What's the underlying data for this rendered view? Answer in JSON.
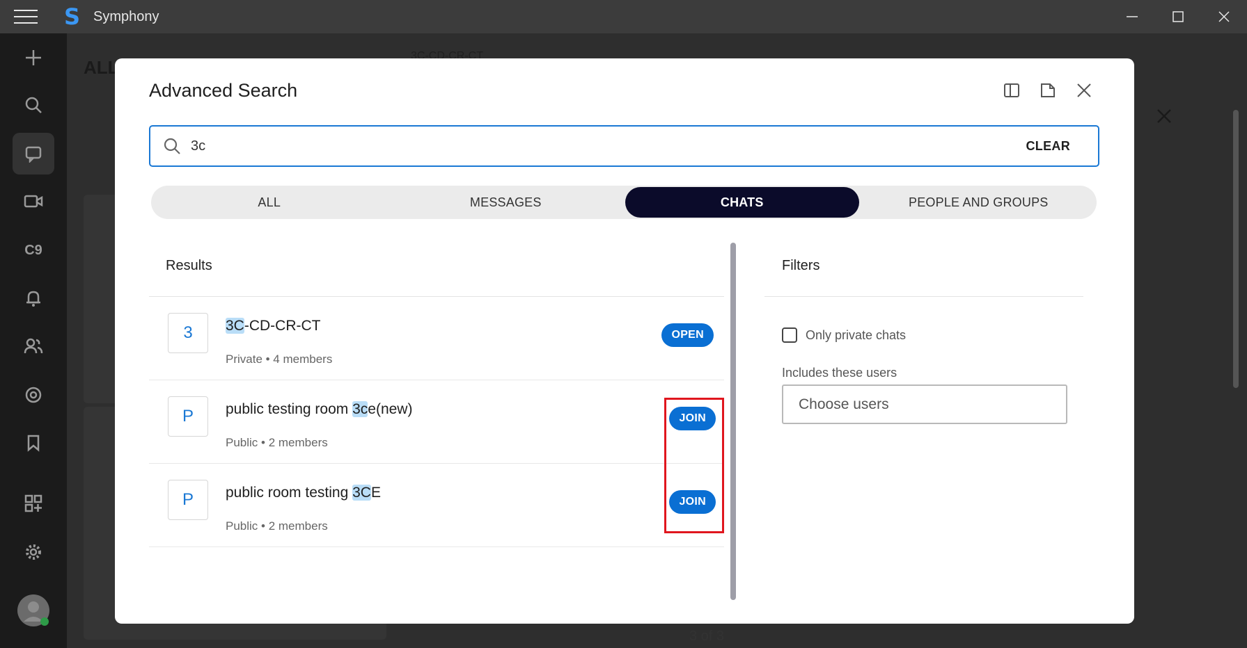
{
  "app": {
    "title": "Symphony",
    "logo": "S"
  },
  "background": {
    "list_title": "ALL",
    "chat_title": "3C-CD-CR-CT",
    "rail_c9": "C9"
  },
  "modal": {
    "title": "Advanced Search",
    "search": {
      "value": "3c",
      "clear_label": "CLEAR"
    },
    "tabs": [
      {
        "label": "ALL",
        "active": false
      },
      {
        "label": "MESSAGES",
        "active": false
      },
      {
        "label": "CHATS",
        "active": true
      },
      {
        "label": "PEOPLE AND GROUPS",
        "active": false
      }
    ],
    "results": {
      "header": "Results",
      "items": [
        {
          "avatar": "3",
          "name_highlight": "3C",
          "name_rest": "-CD-CR-CT",
          "name_prefix": "",
          "meta": "Private • 4 members",
          "action": "OPEN"
        },
        {
          "avatar": "P",
          "name_prefix": "public testing room ",
          "name_highlight": "3c",
          "name_rest": "e(new)",
          "meta": "Public • 2 members",
          "action": "JOIN"
        },
        {
          "avatar": "P",
          "name_prefix": "public room testing ",
          "name_highlight": "3C",
          "name_rest": "E",
          "meta": "Public • 2 members",
          "action": "JOIN"
        }
      ],
      "pagination": "3 of 3"
    },
    "filters": {
      "header": "Filters",
      "private_only_label": "Only private chats",
      "includes_users_label": "Includes these users",
      "users_placeholder": "Choose users"
    }
  },
  "colors": {
    "accent": "#1a78d4",
    "button": "#0a6fd3",
    "active_tab": "#0b0b2a",
    "highlight": "#b9ddf7",
    "annotation": "#e0161e"
  }
}
